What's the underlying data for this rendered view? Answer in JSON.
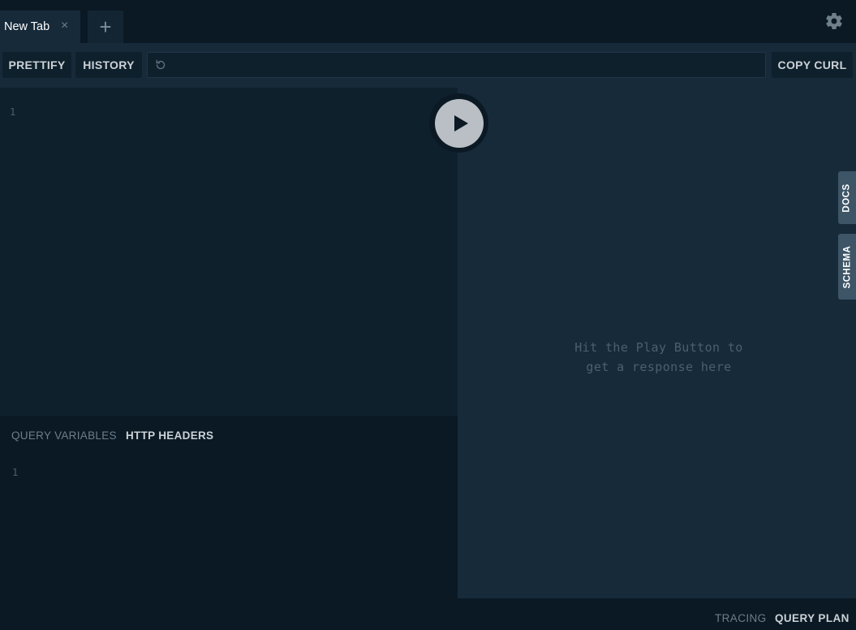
{
  "tabs": {
    "active_title": "New Tab",
    "close_glyph": "×",
    "add_glyph": "+",
    "settings_icon": "gear-icon"
  },
  "toolbar": {
    "prettify_label": "PRETTIFY",
    "history_label": "HISTORY",
    "url_value": "",
    "reload_icon": "reload-icon",
    "copy_curl_label": "COPY CURL"
  },
  "editor": {
    "line_number": "1",
    "content": ""
  },
  "variables": {
    "query_variables_label": "QUERY VARIABLES",
    "http_headers_label": "HTTP HEADERS",
    "line_number": "1"
  },
  "result": {
    "hint_line1": "Hit the Play Button to",
    "hint_line2": "get a response here"
  },
  "side_tabs": {
    "docs_label": "DOCS",
    "schema_label": "SCHEMA"
  },
  "footer": {
    "tracing_label": "TRACING",
    "query_plan_label": "QUERY PLAN"
  },
  "colors": {
    "background": "#0b1924",
    "panel": "#172a3a",
    "editor": "#0f202d",
    "accent_tab": "#3d5566",
    "play_button": "#b9bfc4"
  }
}
